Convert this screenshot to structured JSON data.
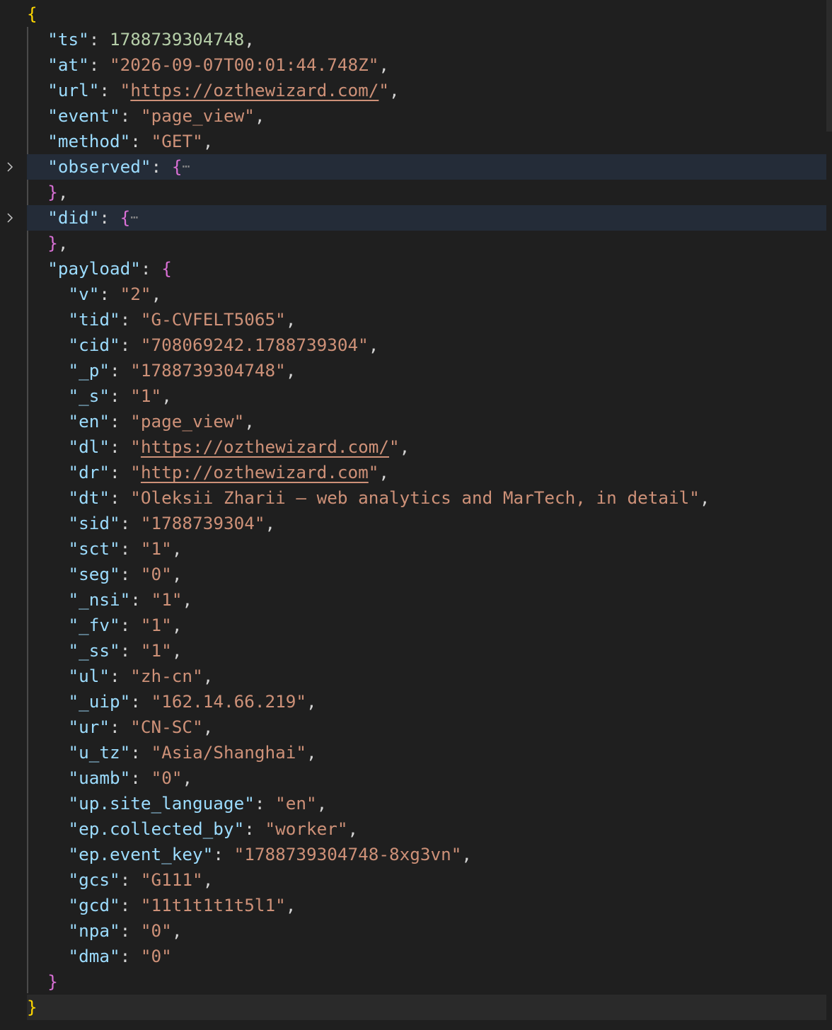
{
  "editor": {
    "language": "json",
    "folded_placeholder": "⋯",
    "colors": {
      "background": "#1f1f1f",
      "key": "#9cdcfe",
      "string": "#ce9178",
      "number": "#b5cea8",
      "bracket_level1": "#ffd700",
      "bracket_level2": "#da70d6",
      "highlight_line": "#242c38"
    },
    "brackets": {
      "root_open": "{",
      "root_close": "}",
      "obj_open": "{",
      "obj_close": "}"
    }
  },
  "document": {
    "ts": {
      "key": "\"ts\"",
      "value": "1788739304748"
    },
    "at": {
      "key": "\"at\"",
      "value": "\"2026-09-07T00:01:44.748Z\""
    },
    "url": {
      "key": "\"url\"",
      "value": "https://ozthewizard.com/"
    },
    "event": {
      "key": "\"event\"",
      "value": "\"page_view\""
    },
    "method": {
      "key": "\"method\"",
      "value": "\"GET\""
    },
    "observed": {
      "key": "\"observed\"",
      "folded": true
    },
    "did": {
      "key": "\"did\"",
      "folded": true
    },
    "payload_key": "\"payload\"",
    "payload": [
      {
        "key": "\"v\"",
        "value": "\"2\""
      },
      {
        "key": "\"tid\"",
        "value": "\"G-CVFELT5065\""
      },
      {
        "key": "\"cid\"",
        "value": "\"708069242.1788739304\""
      },
      {
        "key": "\"_p\"",
        "value": "\"1788739304748\""
      },
      {
        "key": "\"_s\"",
        "value": "\"1\""
      },
      {
        "key": "\"en\"",
        "value": "\"page_view\""
      },
      {
        "key": "\"dl\"",
        "value": "https://ozthewizard.com/",
        "link": true
      },
      {
        "key": "\"dr\"",
        "value": "http://ozthewizard.com",
        "link": true
      },
      {
        "key": "\"dt\"",
        "value": "\"Oleksii Zharii — web analytics and MarTech, in detail\""
      },
      {
        "key": "\"sid\"",
        "value": "\"1788739304\""
      },
      {
        "key": "\"sct\"",
        "value": "\"1\""
      },
      {
        "key": "\"seg\"",
        "value": "\"0\""
      },
      {
        "key": "\"_nsi\"",
        "value": "\"1\""
      },
      {
        "key": "\"_fv\"",
        "value": "\"1\""
      },
      {
        "key": "\"_ss\"",
        "value": "\"1\""
      },
      {
        "key": "\"ul\"",
        "value": "\"zh-cn\""
      },
      {
        "key": "\"_uip\"",
        "value": "\"162.14.66.219\""
      },
      {
        "key": "\"ur\"",
        "value": "\"CN-SC\""
      },
      {
        "key": "\"u_tz\"",
        "value": "\"Asia/Shanghai\""
      },
      {
        "key": "\"uamb\"",
        "value": "\"0\""
      },
      {
        "key": "\"up.site_language\"",
        "value": "\"en\""
      },
      {
        "key": "\"ep.collected_by\"",
        "value": "\"worker\""
      },
      {
        "key": "\"ep.event_key\"",
        "value": "\"1788739304748-8xg3vn\""
      },
      {
        "key": "\"gcs\"",
        "value": "\"G111\""
      },
      {
        "key": "\"gcd\"",
        "value": "\"11t1t1t1t5l1\""
      },
      {
        "key": "\"npa\"",
        "value": "\"0\""
      },
      {
        "key": "\"dma\"",
        "value": "\"0\""
      }
    ]
  }
}
